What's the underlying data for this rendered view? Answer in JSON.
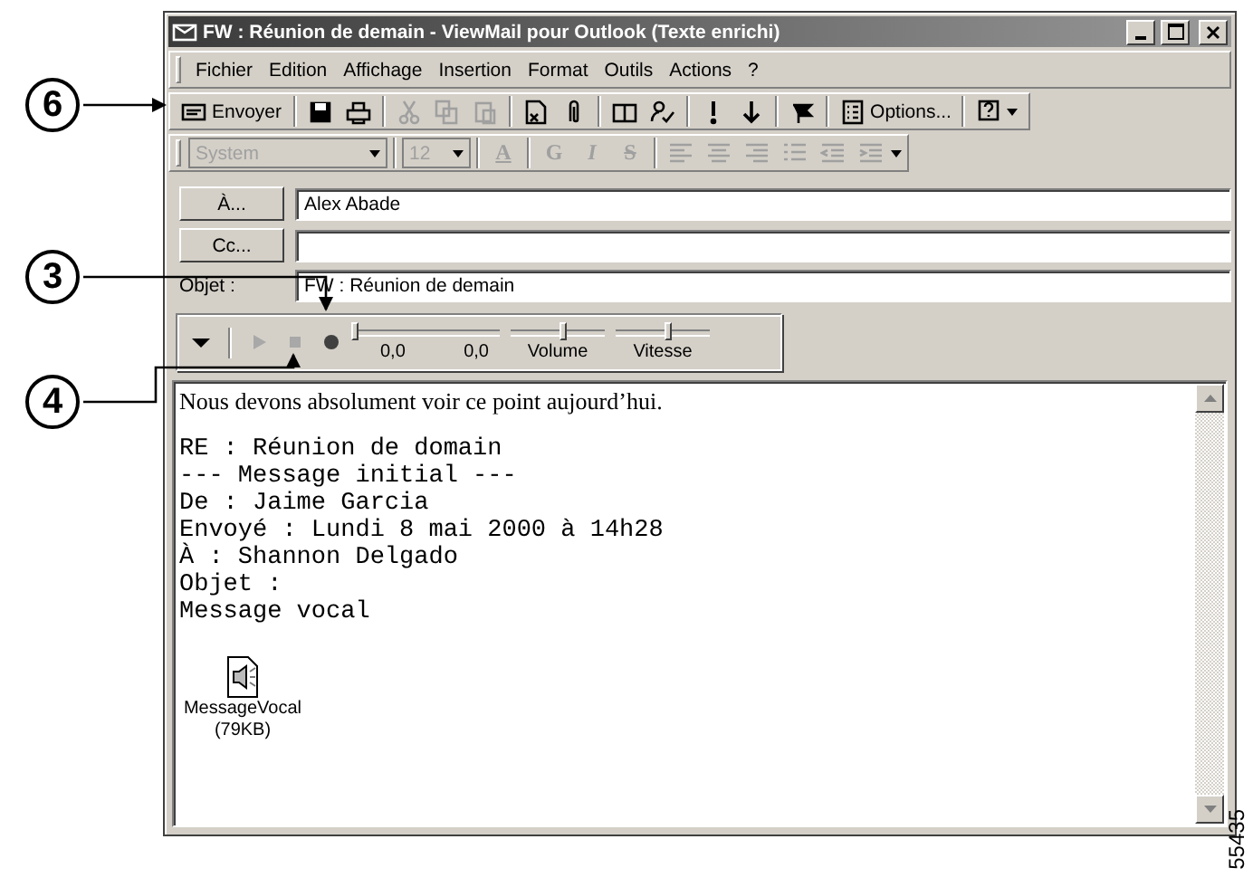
{
  "window": {
    "title": "FW : Réunion de demain - ViewMail pour Outlook (Texte enrichi)"
  },
  "menu": [
    "Fichier",
    "Edition",
    "Affichage",
    "Insertion",
    "Format",
    "Outils",
    "Actions",
    "?"
  ],
  "toolbar": [
    {
      "label": "Envoyer",
      "disabled": false
    },
    {
      "disabled": false
    },
    {
      "disabled": false
    },
    {
      "disabled": true
    },
    {
      "disabled": true
    },
    {
      "disabled": true
    },
    {
      "disabled": false
    },
    {
      "disabled": false
    },
    {
      "disabled": false
    },
    {
      "disabled": false
    },
    {
      "disabled": false
    },
    {
      "disabled": false
    },
    {
      "disabled": false
    },
    {
      "label": "Options...",
      "disabled": false
    },
    {
      "disabled": false
    }
  ],
  "format_toolbar": {
    "disabled": true,
    "font": "System",
    "size": "12",
    "color_letter": "A",
    "styles": [
      "G",
      "I",
      "S"
    ]
  },
  "recipients": [
    {
      "button": "À...",
      "value": "Alex Abade"
    },
    {
      "button": "Cc..."
    }
  ],
  "subject": {
    "label": "Objet :",
    "value": "FW : Réunion de demain"
  },
  "player": {
    "controls": [
      {
        "kind": "menu",
        "disabled": false
      },
      {
        "kind": "play",
        "disabled": true
      },
      {
        "kind": "stop",
        "disabled": true
      },
      {
        "kind": "record",
        "disabled": false
      }
    ],
    "position": {
      "level": 0,
      "start": "0,0",
      "end": "0,0"
    },
    "volume": {
      "label": "Volume",
      "level": 0.55
    },
    "speed": {
      "label": "Vitesse",
      "level": 0.55
    }
  },
  "body": {
    "intro": "Nous devons absolument voir ce point aujourd’hui.",
    "lines": [
      "RE : Réunion de domain",
      "--- Message initial ---",
      "De : Jaime Garcia",
      "Envoyé : Lundi 8 mai 2000 à 14h28",
      "À : Shannon Delgado",
      "Objet :",
      "Message vocal"
    ],
    "attachment": {
      "name": "MessageVocal",
      "size": "(79KB)"
    }
  },
  "callouts": [
    "6",
    "3",
    "4"
  ],
  "figure_number": "55435"
}
